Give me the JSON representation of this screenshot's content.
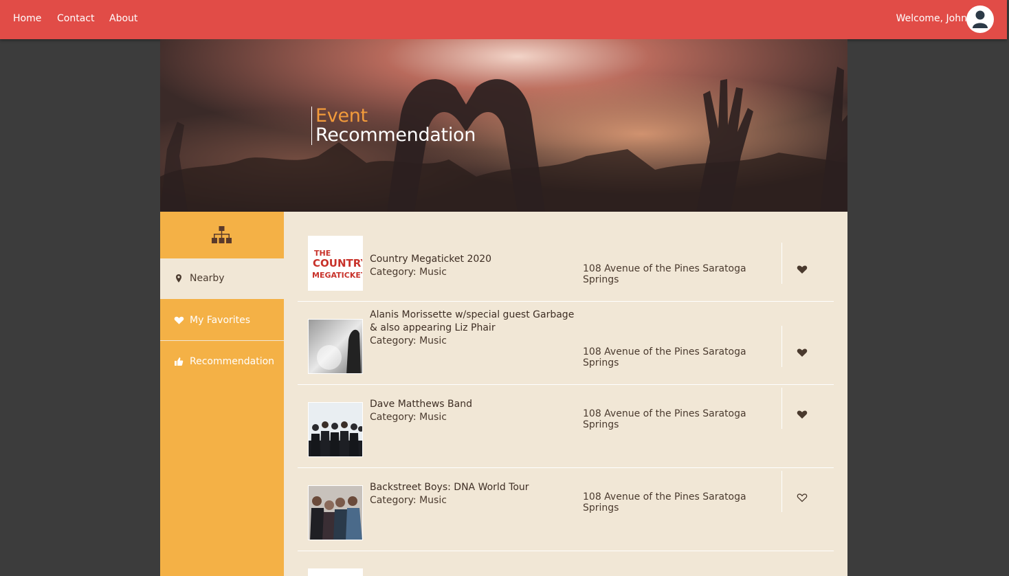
{
  "nav": {
    "links": [
      "Home",
      "Contact",
      "About"
    ],
    "welcome": "Welcome, John"
  },
  "hero": {
    "line1": "Event",
    "line2": "Recommendation"
  },
  "sidebar": {
    "items": [
      {
        "label": "Nearby",
        "icon": "map-marker-icon",
        "active": true
      },
      {
        "label": "My Favorites",
        "icon": "heart-icon",
        "active": false
      },
      {
        "label": "Recommendation",
        "icon": "thumbs-up-icon",
        "active": false
      }
    ]
  },
  "events": [
    {
      "title": "Country Megaticket 2020",
      "category": "Category: Music",
      "address": "108 Avenue of the Pines Saratoga Springs",
      "favorite": true
    },
    {
      "title": "Alanis Morissette w/special guest Garbage & also appearing Liz Phair",
      "category": "Category: Music",
      "address": "108 Avenue of the Pines Saratoga Springs",
      "favorite": true
    },
    {
      "title": "Dave Matthews Band",
      "category": "Category: Music",
      "address": "108 Avenue of the Pines Saratoga Springs",
      "favorite": true
    },
    {
      "title": "Backstreet Boys: DNA World Tour",
      "category": "Category: Music",
      "address": "108 Avenue of the Pines Saratoga Springs",
      "favorite": false
    }
  ],
  "logo_text": [
    "THE",
    "COUNTRY",
    "MEGATICKET"
  ],
  "colors": {
    "nav": "#e14c47",
    "sidebar": "#f4b146",
    "content": "#f1e7d6",
    "accent": "#f39b3b",
    "text": "#4a3a2e"
  }
}
